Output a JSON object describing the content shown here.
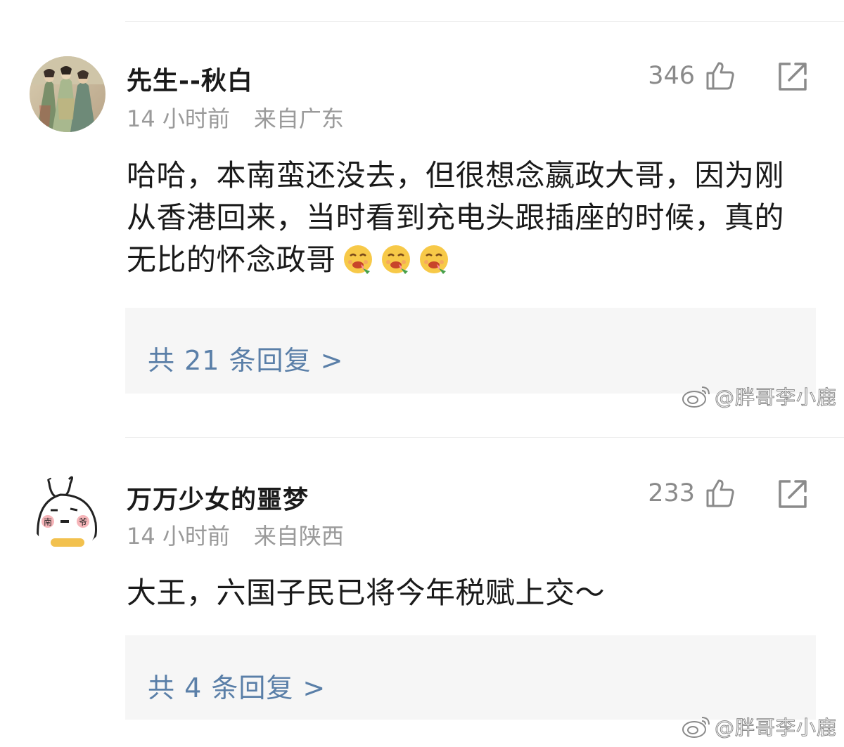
{
  "comments": [
    {
      "username": "先生--秋白",
      "time": "14 小时前",
      "location": "来自广东",
      "likes": "346",
      "text": "哈哈，本南蛮还没去，但很想念嬴政大哥，因为刚从香港回来，当时看到充电头跟插座的时候，真的无比的怀念政哥",
      "emoji_count": 3,
      "replies": "共 21 条回复 >"
    },
    {
      "username": "万万少女的噩梦",
      "time": "14 小时前",
      "location": "来自陕西",
      "likes": "233",
      "text": "大王，六国子民已将今年税赋上交～",
      "replies": "共 4 条回复 >",
      "avatar_text": [
        "南",
        "爷"
      ]
    }
  ],
  "watermark": "@胖哥李小鹿",
  "icons": {
    "like": "thumbs-up-icon",
    "share": "share-icon",
    "emoji": "yum-emoji-icon",
    "watermark": "weibo-logo-icon"
  }
}
